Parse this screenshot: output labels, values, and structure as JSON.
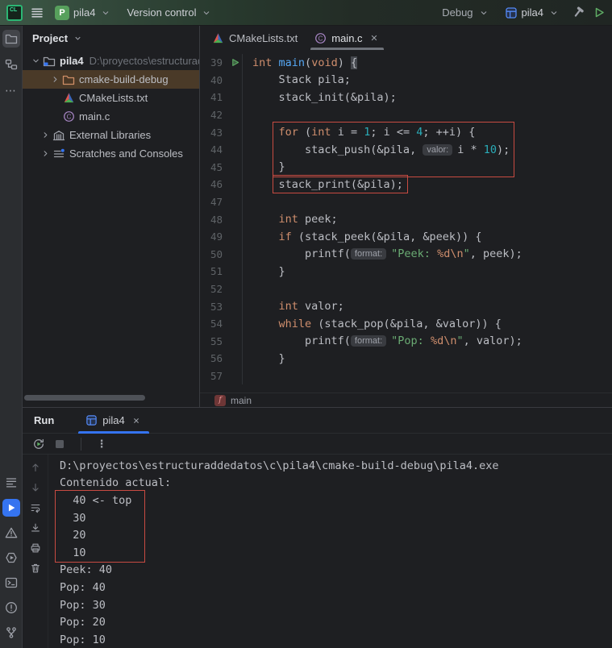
{
  "colors": {
    "accent": "#3574F0",
    "annotation_red": "#C84B42",
    "run_green": "#5FAD65",
    "selection_brown": "#4A3A28"
  },
  "topbar": {
    "logo": "CL",
    "project": {
      "initial": "P",
      "name": "pila4"
    },
    "version_control": "Version control",
    "debug": "Debug",
    "run_config": "pila4"
  },
  "stripe": {
    "top": [
      {
        "icon": "project-folder",
        "active": true
      },
      {
        "icon": "structure",
        "active": false
      },
      {
        "icon": "more-dots",
        "active": false
      }
    ],
    "bottom": [
      {
        "icon": "list-lines",
        "active": false
      },
      {
        "icon": "run-play",
        "active": true
      },
      {
        "icon": "warning",
        "active": false
      },
      {
        "icon": "services",
        "active": false
      },
      {
        "icon": "terminal",
        "active": false
      },
      {
        "icon": "problems",
        "active": false
      },
      {
        "icon": "git-branch",
        "active": false
      }
    ]
  },
  "project_panel": {
    "title": "Project",
    "items": [
      {
        "indent": 0,
        "chevron": "down",
        "icon": "project-folder-badge",
        "label": "pila4",
        "bold": true,
        "path": "D:\\proyectos\\estructuraddedatos",
        "selected": false
      },
      {
        "indent": 1,
        "chevron": "right",
        "icon": "excluded-folder",
        "label": "cmake-build-debug",
        "bold": false,
        "path": "",
        "selected": true
      },
      {
        "indent": 1,
        "chevron": "none",
        "icon": "cmake",
        "label": "CMakeLists.txt",
        "bold": false,
        "path": "",
        "selected": false
      },
      {
        "indent": 1,
        "chevron": "none",
        "icon": "c-file",
        "label": "main.c",
        "bold": false,
        "path": "",
        "selected": false
      },
      {
        "indent": 0.5,
        "chevron": "right",
        "icon": "libraries",
        "label": "External Libraries",
        "bold": false,
        "path": "",
        "selected": false
      },
      {
        "indent": 0.5,
        "chevron": "right",
        "icon": "scratches",
        "label": "Scratches and Consoles",
        "bold": false,
        "path": "",
        "selected": false
      }
    ]
  },
  "editor": {
    "tabs": [
      {
        "icon": "cmake",
        "label": "CMakeLists.txt",
        "active": false,
        "closable": false
      },
      {
        "icon": "c-file",
        "label": "main.c",
        "active": true,
        "closable": true
      }
    ],
    "breadcrumb": {
      "icon_letter": "f",
      "label": "main"
    },
    "lines": [
      {
        "no": 39,
        "run": true,
        "tokens": [
          [
            "int",
            "kw"
          ],
          [
            " ",
            "p"
          ],
          [
            "main",
            "fn"
          ],
          [
            "(",
            "p"
          ],
          [
            "void",
            "kw"
          ],
          [
            ") ",
            "p"
          ],
          [
            "{",
            "brhl"
          ]
        ]
      },
      {
        "no": 40,
        "run": false,
        "tokens": [
          [
            "    Stack pila;",
            "p"
          ]
        ]
      },
      {
        "no": 41,
        "run": false,
        "tokens": [
          [
            "    stack_init(&pila);",
            "p"
          ]
        ]
      },
      {
        "no": 42,
        "run": false,
        "tokens": []
      },
      {
        "no": 43,
        "run": false,
        "tokens": [
          [
            "    ",
            "p"
          ],
          [
            "for",
            "kw"
          ],
          [
            " (",
            "p"
          ],
          [
            "int",
            "kw"
          ],
          [
            " i = ",
            "p"
          ],
          [
            "1",
            "num"
          ],
          [
            "; i <= ",
            "p"
          ],
          [
            "4",
            "num"
          ],
          [
            "; ++i) {",
            "p"
          ]
        ]
      },
      {
        "no": 44,
        "run": false,
        "tokens": [
          [
            "        stack_push(&pila, ",
            "p"
          ],
          [
            "valor:",
            "inlay"
          ],
          [
            "i * ",
            "p"
          ],
          [
            "10",
            "num"
          ],
          [
            ");",
            "p"
          ]
        ]
      },
      {
        "no": 45,
        "run": false,
        "tokens": [
          [
            "    }",
            "p"
          ]
        ]
      },
      {
        "no": 46,
        "run": false,
        "tokens": [
          [
            "    stack_print(&pila);",
            "p"
          ]
        ]
      },
      {
        "no": 47,
        "run": false,
        "tokens": []
      },
      {
        "no": 48,
        "run": false,
        "tokens": [
          [
            "    ",
            "p"
          ],
          [
            "int",
            "kw"
          ],
          [
            " peek;",
            "p"
          ]
        ]
      },
      {
        "no": 49,
        "run": false,
        "tokens": [
          [
            "    ",
            "p"
          ],
          [
            "if",
            "kw"
          ],
          [
            " (stack_peek(&pila, &peek)) {",
            "p"
          ]
        ]
      },
      {
        "no": 50,
        "run": false,
        "tokens": [
          [
            "        printf(",
            "p"
          ],
          [
            "format:",
            "inlay"
          ],
          [
            "\"Peek: ",
            "str"
          ],
          [
            "%d\\n",
            "fmt"
          ],
          [
            "\"",
            "str"
          ],
          [
            ", peek);",
            "p"
          ]
        ]
      },
      {
        "no": 51,
        "run": false,
        "tokens": [
          [
            "    }",
            "p"
          ]
        ]
      },
      {
        "no": 52,
        "run": false,
        "tokens": []
      },
      {
        "no": 53,
        "run": false,
        "tokens": [
          [
            "    ",
            "p"
          ],
          [
            "int",
            "kw"
          ],
          [
            " valor;",
            "p"
          ]
        ]
      },
      {
        "no": 54,
        "run": false,
        "tokens": [
          [
            "    ",
            "p"
          ],
          [
            "while",
            "kw"
          ],
          [
            " (stack_pop(&pila, &valor)) {",
            "p"
          ]
        ]
      },
      {
        "no": 55,
        "run": false,
        "tokens": [
          [
            "        printf(",
            "p"
          ],
          [
            "format:",
            "inlay"
          ],
          [
            "\"Pop: ",
            "str"
          ],
          [
            "%d\\n",
            "fmt"
          ],
          [
            "\"",
            "str"
          ],
          [
            ", valor);",
            "p"
          ]
        ]
      },
      {
        "no": 56,
        "run": false,
        "tokens": [
          [
            "    }",
            "p"
          ]
        ]
      },
      {
        "no": 57,
        "run": false,
        "tokens": []
      }
    ]
  },
  "run_panel": {
    "title": "Run",
    "tab": {
      "icon": "app-window",
      "label": "pila4",
      "closable": true
    },
    "toolbar": [
      {
        "icon": "rerun"
      },
      {
        "icon": "stop"
      },
      {
        "icon": "separator"
      },
      {
        "icon": "kebab"
      }
    ],
    "gutter": [
      {
        "icon": "arrow-up"
      },
      {
        "icon": "arrow-down"
      },
      {
        "icon": "soft-wrap"
      },
      {
        "icon": "scroll-end"
      },
      {
        "icon": "printer"
      },
      {
        "icon": "trash"
      }
    ],
    "console": [
      "D:\\proyectos\\estructuraddedatos\\c\\pila4\\cmake-build-debug\\pila4.exe",
      "Contenido actual:",
      "  40 <- top",
      "  30",
      "  20",
      "  10",
      "Peek: 40",
      "Pop: 40",
      "Pop: 30",
      "Pop: 20",
      "Pop: 10"
    ]
  }
}
